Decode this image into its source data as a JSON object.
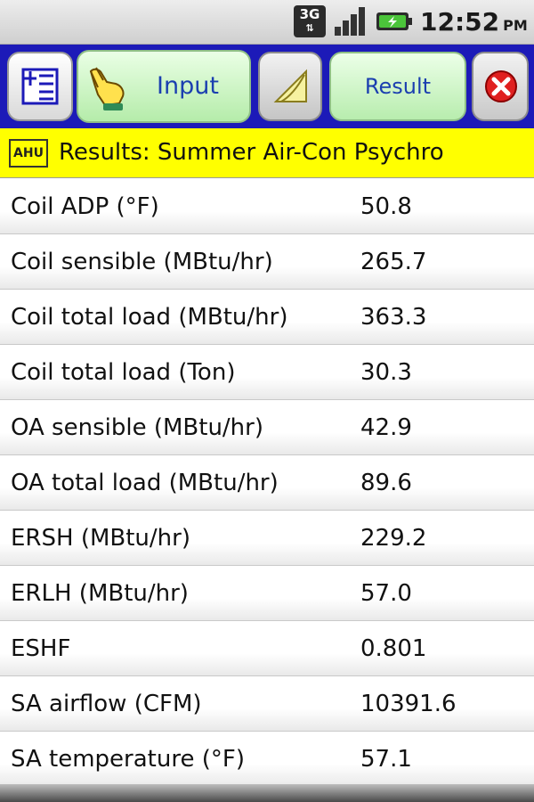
{
  "status_bar": {
    "network": "3G",
    "network_arrows": "⇅",
    "time": "12:52",
    "ampm": "PM",
    "signal_icon": "signal-bars-icon",
    "battery_icon": "battery-charging-icon"
  },
  "toolbar": {
    "add_icon": "add-list-icon",
    "input_label": "Input",
    "input_icon": "pointing-hand-icon",
    "chart_icon": "psychro-chart-icon",
    "result_label": "Result",
    "close_icon": "close-icon"
  },
  "title": {
    "badge": "AHU",
    "text": "Results: Summer Air-Con Psychro"
  },
  "results": [
    {
      "label": "Coil ADP (°F)",
      "value": "50.8"
    },
    {
      "label": "Coil sensible (MBtu/hr)",
      "value": "265.7"
    },
    {
      "label": "Coil total load (MBtu/hr)",
      "value": "363.3"
    },
    {
      "label": "Coil total load (Ton)",
      "value": "30.3"
    },
    {
      "label": "OA sensible (MBtu/hr)",
      "value": "42.9"
    },
    {
      "label": "OA total load (MBtu/hr)",
      "value": "89.6"
    },
    {
      "label": "ERSH (MBtu/hr)",
      "value": "229.2"
    },
    {
      "label": "ERLH (MBtu/hr)",
      "value": "57.0"
    },
    {
      "label": "ESHF",
      "value": "0.801"
    },
    {
      "label": "SA airflow (CFM)",
      "value": "10391.6"
    },
    {
      "label": "SA temperature (°F)",
      "value": "57.1"
    }
  ],
  "colors": {
    "toolbar_bg": "#1c1ab8",
    "title_bg": "#ffff00",
    "button_green": "#b5ecaa",
    "button_text": "#1b3fb0"
  }
}
